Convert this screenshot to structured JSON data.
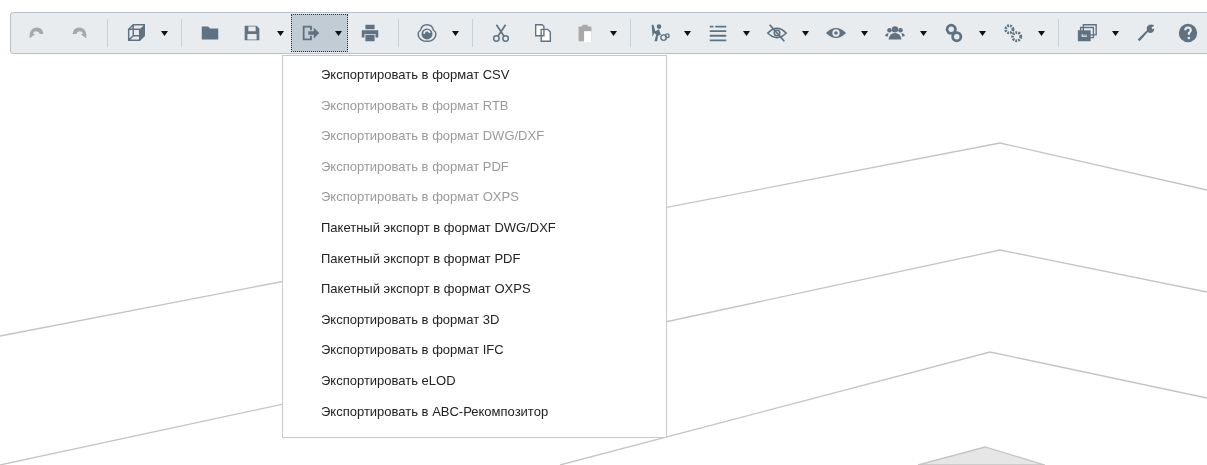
{
  "toolbar": {
    "items": [
      {
        "kind": "button",
        "disabled": true,
        "selected": false,
        "dropdown": false
      },
      {
        "kind": "button",
        "disabled": true,
        "selected": false,
        "dropdown": false
      },
      {
        "kind": "separator"
      },
      {
        "kind": "button",
        "disabled": false,
        "selected": false,
        "dropdown": true
      },
      {
        "kind": "separator"
      },
      {
        "kind": "button",
        "disabled": false,
        "selected": false,
        "dropdown": false
      },
      {
        "kind": "button",
        "disabled": false,
        "selected": false,
        "dropdown": true
      },
      {
        "kind": "button",
        "disabled": false,
        "selected": true,
        "dropdown": true
      },
      {
        "kind": "button",
        "disabled": false,
        "selected": false,
        "dropdown": false
      },
      {
        "kind": "separator"
      },
      {
        "kind": "button",
        "disabled": false,
        "selected": false,
        "dropdown": true
      },
      {
        "kind": "separator"
      },
      {
        "kind": "button",
        "disabled": false,
        "selected": false,
        "dropdown": false
      },
      {
        "kind": "button",
        "disabled": false,
        "selected": false,
        "dropdown": false
      },
      {
        "kind": "button",
        "disabled": true,
        "selected": false,
        "dropdown": true
      },
      {
        "kind": "separator"
      },
      {
        "kind": "button",
        "disabled": false,
        "selected": false,
        "dropdown": true
      },
      {
        "kind": "button",
        "disabled": false,
        "selected": false,
        "dropdown": true
      },
      {
        "kind": "button",
        "disabled": false,
        "selected": false,
        "dropdown": true
      },
      {
        "kind": "button",
        "disabled": false,
        "selected": false,
        "dropdown": true
      },
      {
        "kind": "button",
        "disabled": false,
        "selected": false,
        "dropdown": true
      },
      {
        "kind": "button",
        "disabled": false,
        "selected": false,
        "dropdown": true
      },
      {
        "kind": "button",
        "disabled": false,
        "selected": false,
        "dropdown": true
      },
      {
        "kind": "separator"
      },
      {
        "kind": "button",
        "disabled": false,
        "selected": false,
        "dropdown": true
      },
      {
        "kind": "button",
        "disabled": false,
        "selected": false,
        "dropdown": false
      },
      {
        "kind": "button",
        "disabled": false,
        "selected": false,
        "dropdown": false
      }
    ]
  },
  "export_menu": {
    "items": [
      {
        "label": "Экспортировать в формат CSV",
        "disabled": false
      },
      {
        "label": "Экспортировать в формат RTB",
        "disabled": true
      },
      {
        "label": "Экспортировать в формат DWG/DXF",
        "disabled": true
      },
      {
        "label": "Экспортировать в формат PDF",
        "disabled": true
      },
      {
        "label": "Экспортировать в формат OXPS",
        "disabled": true
      },
      {
        "label": "Пакетный экспорт в формат DWG/DXF",
        "disabled": false
      },
      {
        "label": "Пакетный экспорт в формат PDF",
        "disabled": false
      },
      {
        "label": "Пакетный экспорт в формат OXPS",
        "disabled": false
      },
      {
        "label": "Экспортировать в формат 3D",
        "disabled": false
      },
      {
        "label": "Экспортировать в формат IFC",
        "disabled": false
      },
      {
        "label": "Экспортировать eLOD",
        "disabled": false
      },
      {
        "label": "Экспортировать в ABC-Рекомпозитор",
        "disabled": false
      }
    ]
  }
}
